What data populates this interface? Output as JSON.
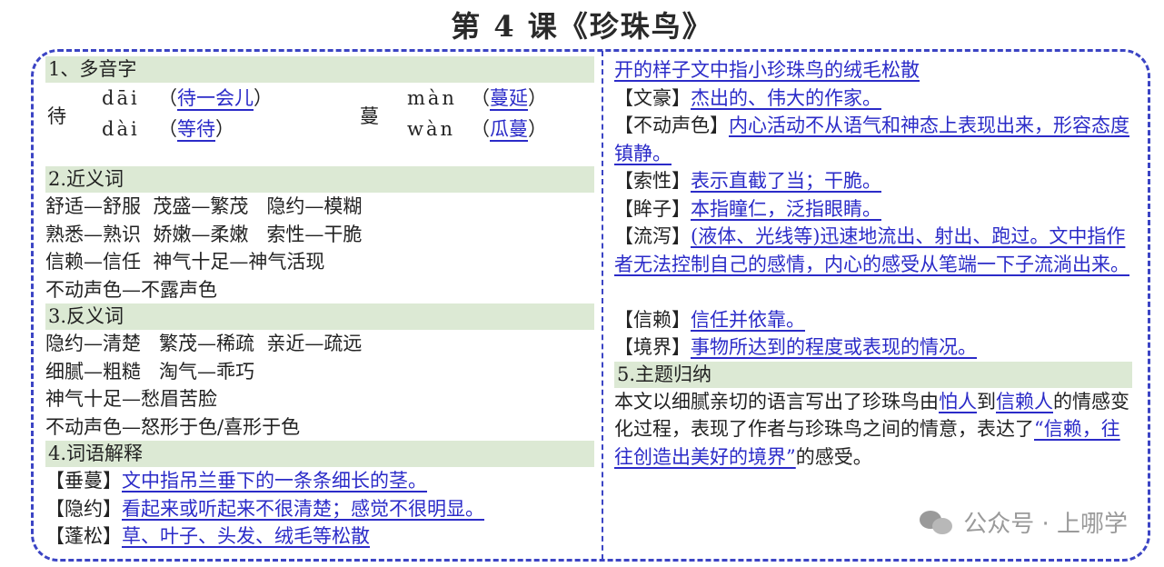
{
  "title": "第 4 课《珍珠鸟》",
  "left": {
    "s1_head": "1、多音字",
    "char1": "待",
    "char1_r1_py": "dāi",
    "char1_r1_word": "待一会儿",
    "char1_r2_py": "dài",
    "char1_r2_word": "等待",
    "char2": "蔓",
    "char2_r1_py": "màn",
    "char2_r1_word": "蔓延",
    "char2_r2_py": "wàn",
    "char2_r2_word": "瓜蔓",
    "s2_head": "2.近义词",
    "syn": [
      "舒适—舒服  茂盛—繁茂   隐约—模糊",
      "熟悉—熟识  娇嫩—柔嫩   索性—干脆",
      "信赖—信任  神气十足—神气活现",
      "不动声色—不露声色"
    ],
    "s3_head": "3.反义词",
    "ant": [
      "隐约—清楚   繁茂—稀疏  亲近—疏远",
      "细腻—粗糙   淘气—乖巧",
      "神气十足—愁眉苦脸",
      "不动声色—怒形于色/喜形于色"
    ],
    "s4_head": "4.词语解释",
    "defs": [
      {
        "term": "【垂蔓】",
        "text": "文中指吊兰垂下的一条条细长的茎。"
      },
      {
        "term": "【隐约】",
        "text": "看起来或听起来不很清楚；感觉不很明显。"
      },
      {
        "term": "【蓬松】",
        "text": "草、叶子、头发、绒毛等松散"
      }
    ]
  },
  "right": {
    "cont": "开的样子文中指小珍珠鸟的绒毛松散",
    "defs": [
      {
        "term": "【文豪】",
        "text": "杰出的、伟大的作家。"
      },
      {
        "term": "【不动声色】",
        "text": "内心活动不从语气和神态上表现出来，形容态度镇静。"
      },
      {
        "term": "【索性】",
        "text": "表示直截了当；干脆。"
      },
      {
        "term": "【眸子】",
        "text": "本指瞳仁，泛指眼睛。"
      },
      {
        "term": "【流泻】",
        "text": "(液体、光线等)迅速地流出、射出、跑过。文中指作者无法控制自己的感情，内心的感受从笔端一下子流淌出来。"
      },
      {
        "term": "【信赖】",
        "text": "信任并依靠。"
      },
      {
        "term": "【境界】",
        "text": "事物所达到的程度或表现的情况。"
      }
    ],
    "s5_head": "5.主题归纳",
    "theme_a": "本文以细腻亲切的语言写出了珍珠鸟由",
    "theme_b": "怕人",
    "theme_c": "到",
    "theme_d": "信赖人",
    "theme_e": "的情感变化过程，表现了作者与珍珠鸟之间的情意，表达了",
    "theme_f": "“信赖，往往创造出美好的境界”",
    "theme_g": "的感受。"
  },
  "watermark": "公众号 · 上哪学"
}
